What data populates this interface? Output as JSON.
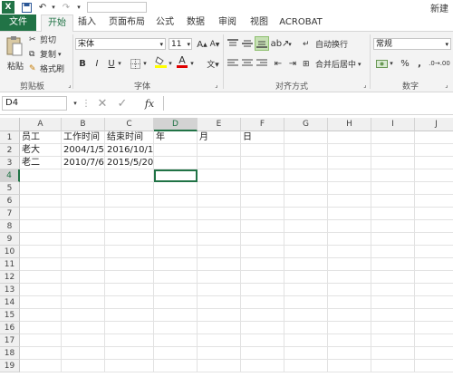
{
  "title_bar": {
    "excel_icon": "excel-logo-icon",
    "right_text": "新建"
  },
  "tabs": [
    {
      "label": "文件"
    },
    {
      "label": "开始"
    },
    {
      "label": "插入"
    },
    {
      "label": "页面布局"
    },
    {
      "label": "公式"
    },
    {
      "label": "数据"
    },
    {
      "label": "审阅"
    },
    {
      "label": "视图"
    },
    {
      "label": "ACROBAT"
    }
  ],
  "clipboard": {
    "paste": "粘贴",
    "cut": "剪切",
    "copy": "复制",
    "format_painter": "格式刷",
    "group": "剪贴板"
  },
  "font": {
    "name": "宋体",
    "size": "11",
    "bold": "B",
    "italic": "I",
    "underline": "U",
    "group": "字体"
  },
  "alignment": {
    "wrap": "自动换行",
    "merge": "合并后居中",
    "group": "对齐方式"
  },
  "number": {
    "format": "常规",
    "percent": "%",
    "comma": ",",
    "group": "数字"
  },
  "formula_bar": {
    "name_box": "D4",
    "fx": "fx",
    "value": ""
  },
  "columns": [
    "A",
    "B",
    "C",
    "D",
    "E",
    "F",
    "G",
    "H",
    "I",
    "J"
  ],
  "rows": [
    "1",
    "2",
    "3",
    "4",
    "5",
    "6",
    "7",
    "8",
    "9",
    "10",
    "11",
    "12",
    "13",
    "14",
    "15",
    "16",
    "17",
    "18",
    "19"
  ],
  "cells": {
    "A1": "员工",
    "B1": "工作时间",
    "C1": "结束时间",
    "D1": "年",
    "E1": "月",
    "F1": "日",
    "A2": "老大",
    "B2": "2004/1/5",
    "C2": "2016/10/1",
    "A3": "老二",
    "B3": "2010/7/6",
    "C3": "2015/5/20"
  },
  "active_cell": "D4"
}
